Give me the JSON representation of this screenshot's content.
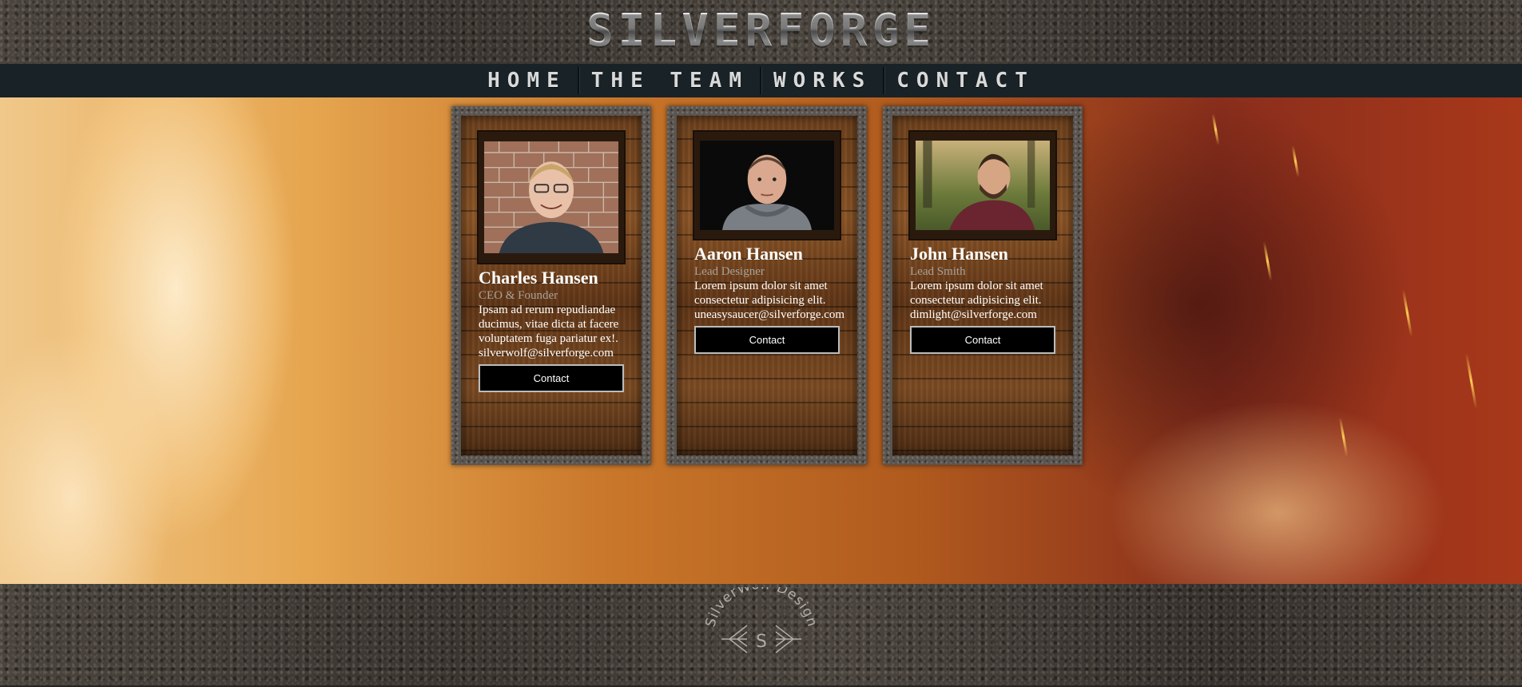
{
  "brand": {
    "title": "SILVERFORGE"
  },
  "nav": {
    "items": [
      {
        "label": "HOME"
      },
      {
        "label": "THE TEAM"
      },
      {
        "label": "WORKS"
      },
      {
        "label": "CONTACT"
      }
    ]
  },
  "team": [
    {
      "name": "Charles Hansen",
      "role": "CEO & Founder",
      "bio": "Ipsam ad rerum repudiandae ducimus, vitae dicta at facere voluptatem fuga pariatur ex!.",
      "email": "silverwolf@silverforge.com",
      "button": "Contact"
    },
    {
      "name": "Aaron Hansen",
      "role": "Lead Designer",
      "bio": "Lorem ipsum dolor sit amet consectetur adipisicing elit.",
      "email": "uneasysaucer@silverforge.com",
      "button": "Contact"
    },
    {
      "name": "John Hansen",
      "role": "Lead Smith",
      "bio": "Lorem ipsum dolor sit amet consectetur adipisicing elit.",
      "email": "dimlight@silverforge.com",
      "button": "Contact"
    }
  ],
  "footer": {
    "logo_text": "SilverWolf Design",
    "logo_letter": "S"
  },
  "colors": {
    "nav_bg": "#182227",
    "button_bg": "#000000",
    "role_text": "#a8a29a"
  }
}
